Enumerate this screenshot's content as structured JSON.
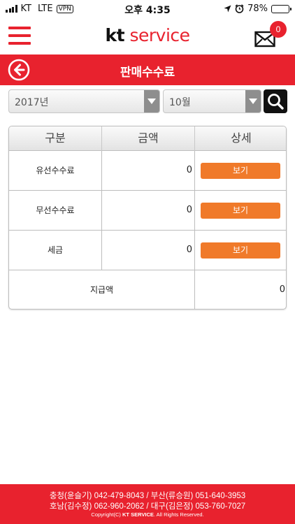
{
  "status_bar": {
    "carrier": "KT",
    "network": "LTE",
    "vpn": "VPN",
    "time": "오후 4:35",
    "battery": "78%",
    "battery_level": 0.78
  },
  "header": {
    "logo_kt": "kt",
    "logo_service": "service",
    "message_count": "0"
  },
  "title_bar": {
    "title": "판매수수료"
  },
  "filters": {
    "year": "2017년",
    "month": "10월"
  },
  "table": {
    "columns": [
      "구분",
      "금액",
      "상세"
    ],
    "rows": [
      {
        "name": "유선수수료",
        "amount": "0",
        "action": "보기"
      },
      {
        "name": "무선수수료",
        "amount": "0",
        "action": "보기"
      },
      {
        "name": "세금",
        "amount": "0",
        "action": "보기"
      }
    ],
    "total": {
      "label": "지급액",
      "amount": "0"
    }
  },
  "footer": {
    "line1": "충청(윤슬기) 042-479-8043  /  부산(류승원) 051-640-3953",
    "line2": "호남(김수정) 062-960-2062  /  대구(김은정) 053-760-7027",
    "copyright_prefix": "Copyright(C)",
    "copyright_brand": "KT SERVICE",
    "copyright_suffix": ". All Rights Reserved."
  },
  "colors": {
    "brand_red": "#e8222e",
    "button_orange": "#f07a2a"
  },
  "icons": [
    "hamburger-icon",
    "mail-icon",
    "back-arrow-icon",
    "dropdown-arrow-icon",
    "search-icon",
    "signal-icon",
    "location-icon",
    "alarm-icon",
    "battery-icon"
  ]
}
